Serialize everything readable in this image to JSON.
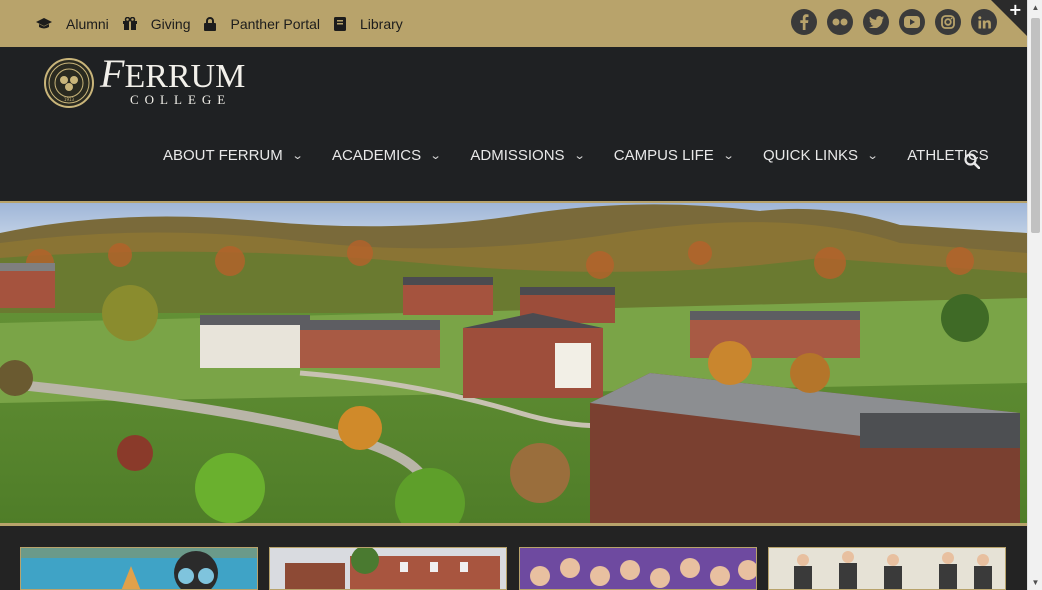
{
  "utility": {
    "links": [
      {
        "label": "Alumni",
        "icon": "graduation-cap-icon"
      },
      {
        "label": "Giving",
        "icon": "gift-icon"
      },
      {
        "label": "Panther Portal",
        "icon": "lock-icon"
      },
      {
        "label": "Library",
        "icon": "book-icon"
      }
    ],
    "social": [
      "facebook-icon",
      "flickr-icon",
      "twitter-icon",
      "youtube-icon",
      "instagram-icon",
      "linkedin-icon"
    ],
    "corner_plus": "+"
  },
  "logo": {
    "name_initial": "F",
    "name_rest": "ERRUM",
    "sub": "COLLEGE",
    "seal_year": "1913"
  },
  "nav": {
    "items": [
      {
        "label": "ABOUT FERRUM",
        "has_dropdown": true
      },
      {
        "label": "ACADEMICS",
        "has_dropdown": true
      },
      {
        "label": "ADMISSIONS",
        "has_dropdown": true
      },
      {
        "label": "CAMPUS LIFE",
        "has_dropdown": true
      },
      {
        "label": "QUICK LINKS",
        "has_dropdown": true
      },
      {
        "label": "ATHLETICS",
        "has_dropdown": false
      }
    ],
    "chevron": "⌄"
  },
  "colors": {
    "gold": "#b8a36b",
    "header_bg": "#1f2123",
    "topbar_bg": "#b8a36b"
  }
}
